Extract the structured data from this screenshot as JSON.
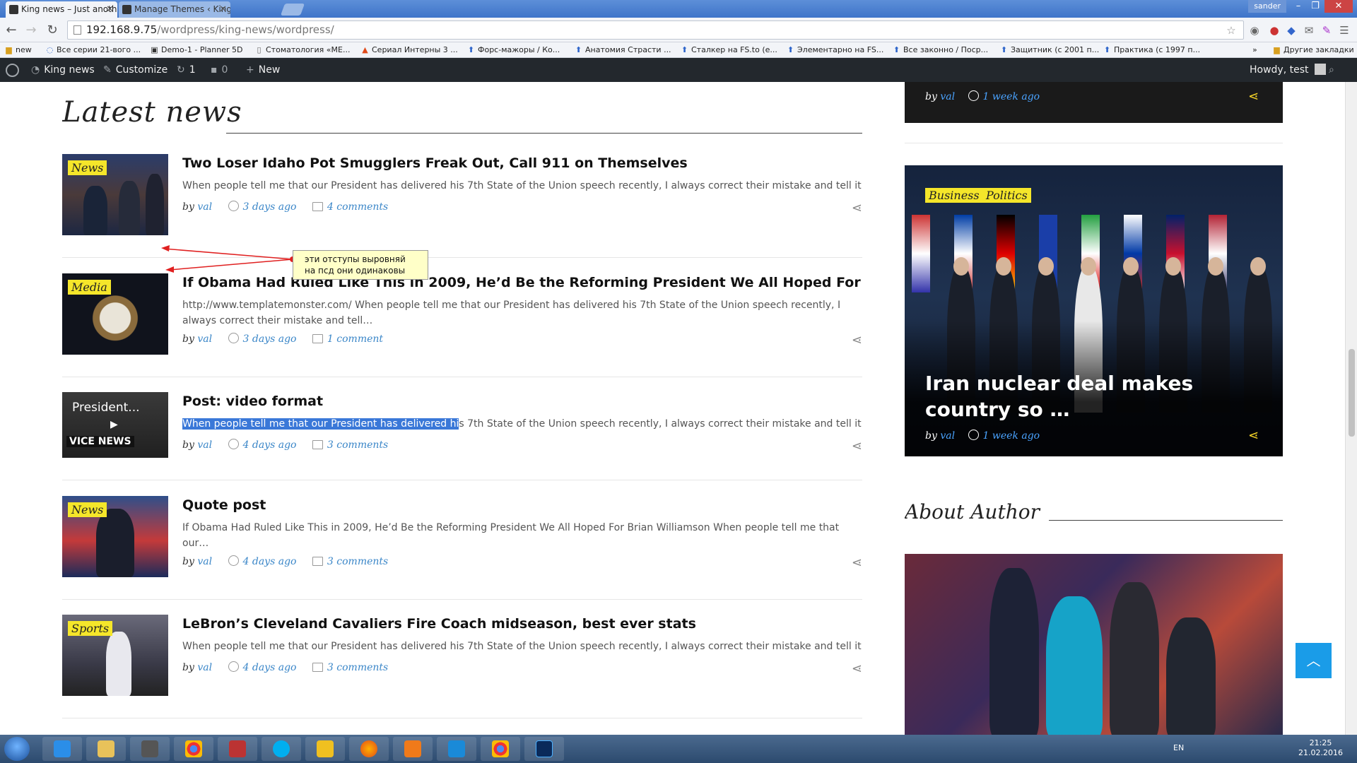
{
  "browser": {
    "tabs": [
      {
        "title": "King news – Just another \\",
        "active": true
      },
      {
        "title": "Manage Themes ‹ King ne",
        "active": false
      }
    ],
    "user": "sander",
    "url_host": "192.168.9.75",
    "url_path": "/wordpress/king-news/wordpress/",
    "bookmarks": [
      "new",
      "Все серии 21-вого ...",
      "Demo-1 - Planner 5D",
      "Стоматология «МЕ...",
      "Сериал Интерны 3 ...",
      "Форс-мажоры / Ко...",
      "Анатомия Страсти ...",
      "Сталкер на FS.to (е...",
      "Элементарно на FS...",
      "Все законно / Поср...",
      "Защитник (с 2001 п...",
      "Практика (с 1997 п..."
    ],
    "bookmarks_more": "»",
    "other_bookmarks": "Другие закладки"
  },
  "adminbar": {
    "site": "King news",
    "customize": "Customize",
    "updates": "1",
    "comments": "0",
    "new": "New",
    "howdy": "Howdy, test"
  },
  "main": {
    "section_title": "Latest news",
    "posts": [
      {
        "category": "News",
        "title": "Two Loser Idaho Pot Smugglers Freak Out, Call 911 on Themselves",
        "excerpt": "When people tell me that our President has delivered his 7th State of the Union speech recently, I always correct their mistake and tell it…",
        "by": "by",
        "author": "val",
        "date": "3 days ago",
        "comments": "4 comments"
      },
      {
        "category": "Media",
        "title": "If Obama Had Ruled Like This in 2009, He’d Be the Reforming President We All Hoped For",
        "excerpt": "http://www.templatemonster.com/ When people tell me that our President has delivered his 7th State of the Union speech recently, I always correct their mistake and tell…",
        "by": "by",
        "author": "val",
        "date": "3 days ago",
        "comments": "1 comment"
      },
      {
        "category": "",
        "video_title": "President...",
        "video_logo": "VICE NEWS",
        "title": "Post: video format",
        "excerpt_selected": "When people tell me that our President has delivered hi",
        "excerpt_rest": "s 7th State of the Union speech recently, I always correct their mistake and tell it…",
        "by": "by",
        "author": "val",
        "date": "4 days ago",
        "comments": "3 comments"
      },
      {
        "category": "News",
        "title": "Quote post",
        "excerpt": "If Obama Had Ruled Like This in 2009, He’d Be the Reforming President We All Hoped For Brian Williamson When people tell me that our…",
        "by": "by",
        "author": "val",
        "date": "4 days ago",
        "comments": "3 comments"
      },
      {
        "category": "Sports",
        "title": "LeBron’s Cleveland Cavaliers Fire Coach midseason, best ever stats",
        "excerpt": "When people tell me that our President has delivered his 7th State of the Union speech recently, I always correct their mistake and tell it…",
        "by": "by",
        "author": "val",
        "date": "4 days ago",
        "comments": "3 comments"
      }
    ]
  },
  "annotation": {
    "line1": "эти отступы выровняй",
    "line2": "на псд они одинаковы"
  },
  "sidebar": {
    "top_card": {
      "by": "by",
      "author": "val",
      "date": "1 week ago"
    },
    "feature": {
      "categories": [
        "Business",
        "Politics"
      ],
      "title": "Iran nuclear deal makes country so …",
      "by": "by",
      "author": "val",
      "date": "1 week ago"
    },
    "about_title": "About Author"
  },
  "taskbar": {
    "lang": "EN",
    "time": "21:25",
    "date": "21.02.2016"
  },
  "icons": {
    "share": "share-icon",
    "clock": "clock-icon",
    "comment": "comment-icon",
    "back_to_top": "chevron-up-icon"
  },
  "colors": {
    "badge": "#f5e62a",
    "link": "#3a86c8",
    "adminbar": "#23282d",
    "back_to_top": "#1a9ce8",
    "selection": "#3a78d8"
  }
}
